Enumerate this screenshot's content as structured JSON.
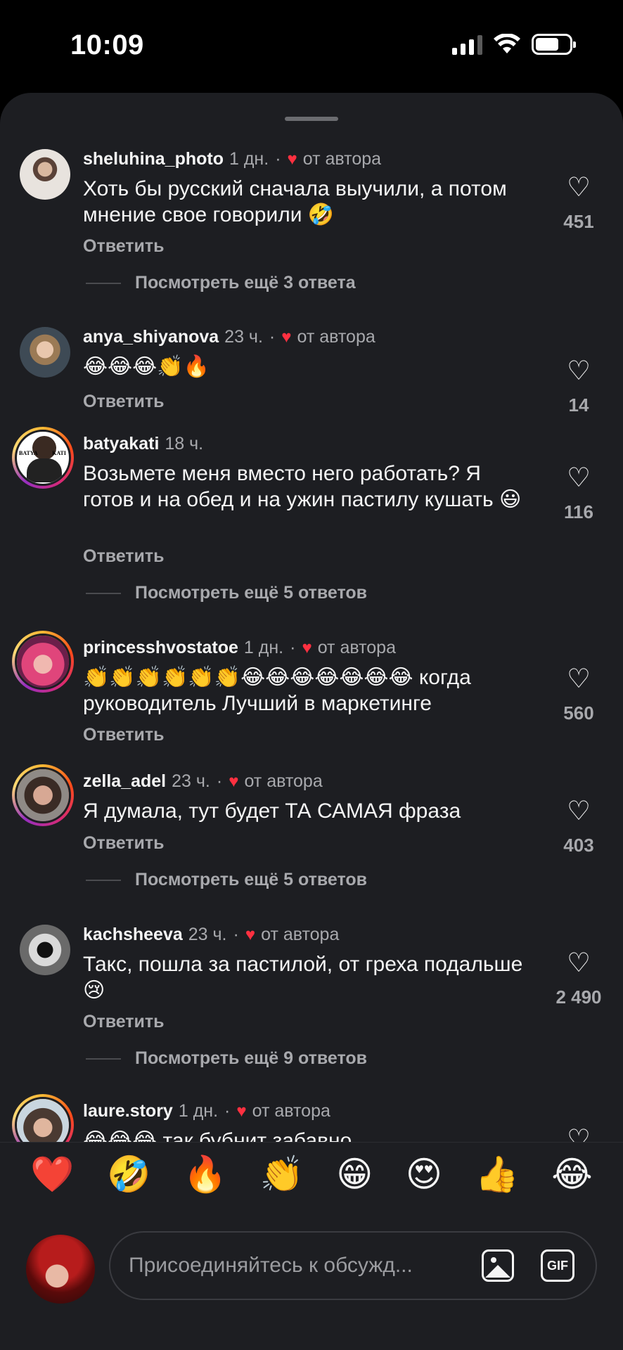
{
  "status": {
    "time": "10:09"
  },
  "comments": [
    {
      "username": "sheluhina_photo",
      "time": "1 дн.",
      "author_badge": "от автора",
      "text": "Хоть бы русский сначала выучили, а потом мнение свое говорили 🤣",
      "reply": "Ответить",
      "likes": "451",
      "more_replies": "Посмотреть ещё 3 ответа"
    },
    {
      "username": "anya_shiyanova",
      "time": "23 ч.",
      "author_badge": "от автора",
      "text": "😂😂😂👏🔥",
      "reply": "Ответить",
      "likes": "14"
    },
    {
      "username": "batyakati",
      "time": "18 ч.",
      "text": "Возьмете меня вместо него работать? Я готов и на обед и на ужин пастилу кушать 😃",
      "reply": "Ответить",
      "likes": "116",
      "more_replies": "Посмотреть ещё 5 ответов",
      "avatar_text_left": "BATYA",
      "avatar_text_right": "KATI"
    },
    {
      "username": "princesshvostatoe",
      "time": "1 дн.",
      "author_badge": "от автора",
      "text": "👏👏👏👏👏👏😂😂😂😂😂😂😂 когда руководитель Лучший в маркетинге",
      "reply": "Ответить",
      "likes": "560"
    },
    {
      "username": "zella_adel",
      "time": "23 ч.",
      "author_badge": "от автора",
      "text": "Я думала, тут будет ТА САМАЯ фраза",
      "reply": "Ответить",
      "likes": "403",
      "more_replies": "Посмотреть ещё 5 ответов"
    },
    {
      "username": "kachsheeva",
      "time": "23 ч.",
      "author_badge": "от автора",
      "text": "Такс, пошла за пастилой, от греха подальше😢",
      "reply": "Ответить",
      "likes": "2 490",
      "more_replies": "Посмотреть ещё 9 ответов"
    },
    {
      "username": "laure.story",
      "time": "1 дн.",
      "author_badge": "от автора",
      "text": "😂😂😂 так бубнит забавно"
    }
  ],
  "reactions": [
    "❤️",
    "🤣",
    "🔥",
    "👏",
    "😁",
    "😍",
    "👍",
    "😂"
  ],
  "input": {
    "placeholder": "Присоединяйтесь к обсужд...",
    "gif_label": "GIF"
  },
  "colors": {
    "background": "#1d1e22",
    "text": "#f5f5f5",
    "secondary": "#a8a9ad",
    "heart_red": "#ff3040"
  }
}
